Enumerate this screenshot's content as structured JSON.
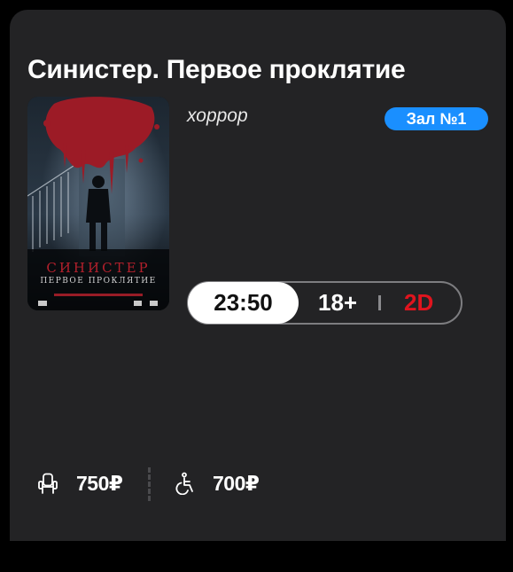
{
  "movie": {
    "title": "Синистер. Первое проклятие",
    "genre": "хоррор",
    "hall": "Зал №1",
    "poster": {
      "title": "СИНИСТЕР",
      "subtitle": "ПЕРВОЕ ПРОКЛЯТИЕ"
    }
  },
  "session": {
    "time": "23:50",
    "age_rating": "18+",
    "format": "2D"
  },
  "prices": [
    {
      "icon": "seat-icon",
      "value": "750₽"
    },
    {
      "icon": "wheelchair-icon",
      "value": "700₽"
    }
  ],
  "colors": {
    "card_background": "#232325",
    "page_background": "#000000",
    "hall_badge": "#1a8fff",
    "format_accent": "#e0141e",
    "session_time_bg": "#ffffff"
  }
}
